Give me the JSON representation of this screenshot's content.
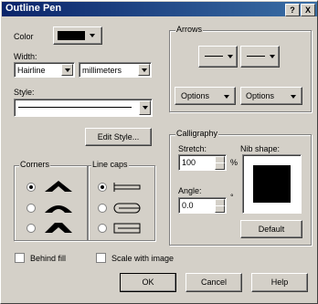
{
  "window": {
    "title": "Outline Pen",
    "help_button": "?",
    "close_button": "X"
  },
  "color": {
    "label": "Color",
    "swatch": "#000000"
  },
  "width": {
    "label": "Width:",
    "value": "Hairline",
    "units": "millimeters"
  },
  "style": {
    "label": "Style:"
  },
  "edit_style": "Edit Style...",
  "corners": {
    "label": "Corners"
  },
  "line_caps": {
    "label": "Line caps"
  },
  "arrows": {
    "label": "Arrows",
    "options_left": "Options",
    "options_right": "Options"
  },
  "calligraphy": {
    "label": "Calligraphy",
    "stretch_label": "Stretch:",
    "stretch_value": "100",
    "stretch_unit": "%",
    "angle_label": "Angle:",
    "angle_value": "0.0",
    "angle_unit": "°",
    "nib_label": "Nib shape:",
    "default_button": "Default"
  },
  "behind_fill": "Behind fill",
  "scale_with_image": "Scale with image",
  "buttons": {
    "ok": "OK",
    "cancel": "Cancel",
    "help": "Help"
  }
}
